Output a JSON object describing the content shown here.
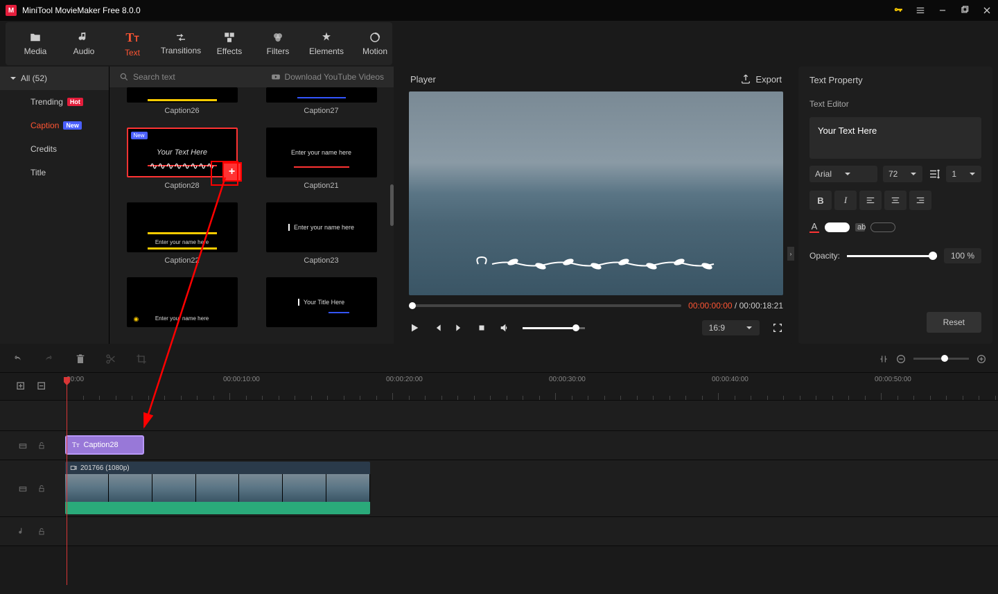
{
  "app": {
    "title": "MiniTool MovieMaker Free 8.0.0"
  },
  "topTabs": [
    {
      "label": "Media"
    },
    {
      "label": "Audio"
    },
    {
      "label": "Text"
    },
    {
      "label": "Transitions"
    },
    {
      "label": "Effects"
    },
    {
      "label": "Filters"
    },
    {
      "label": "Elements"
    },
    {
      "label": "Motion"
    }
  ],
  "sidebar": {
    "all": "All (52)",
    "items": [
      {
        "label": "Trending",
        "badge": "Hot"
      },
      {
        "label": "Caption",
        "badge": "New"
      },
      {
        "label": "Credits"
      },
      {
        "label": "Title"
      }
    ]
  },
  "assetToolbar": {
    "search": "Search text",
    "download": "Download YouTube Videos"
  },
  "assets": [
    {
      "label": "Caption26"
    },
    {
      "label": "Caption27"
    },
    {
      "label": "Caption28",
      "thumbText": "Your Text Here",
      "selected": true,
      "new": true
    },
    {
      "label": "Caption21",
      "thumbText": "Enter your name here"
    },
    {
      "label": "Caption22",
      "thumbText": "Enter your name here"
    },
    {
      "label": "Caption23",
      "thumbText": "Enter your name here"
    },
    {
      "label": "",
      "thumbText": "Enter your name here"
    },
    {
      "label": "",
      "thumbText": "Your Title Here"
    }
  ],
  "player": {
    "title": "Player",
    "export": "Export",
    "current": "00:00:00:00",
    "total": "00:00:18:21",
    "sep": " / ",
    "aspect": "16:9"
  },
  "props": {
    "title": "Text Property",
    "section": "Text Editor",
    "textValue": "Your Text Here",
    "font": "Arial",
    "size": "72",
    "line": "1",
    "opacityLabel": "Opacity:",
    "opacityVal": "100 %",
    "reset": "Reset",
    "abLabel": "ab"
  },
  "timeline": {
    "marks": [
      "00:00",
      "00:00:10:00",
      "00:00:20:00",
      "00:00:30:00",
      "00:00:40:00",
      "00:00:50:00"
    ],
    "textClip": "Caption28",
    "videoClip": "201766 (1080p)"
  }
}
